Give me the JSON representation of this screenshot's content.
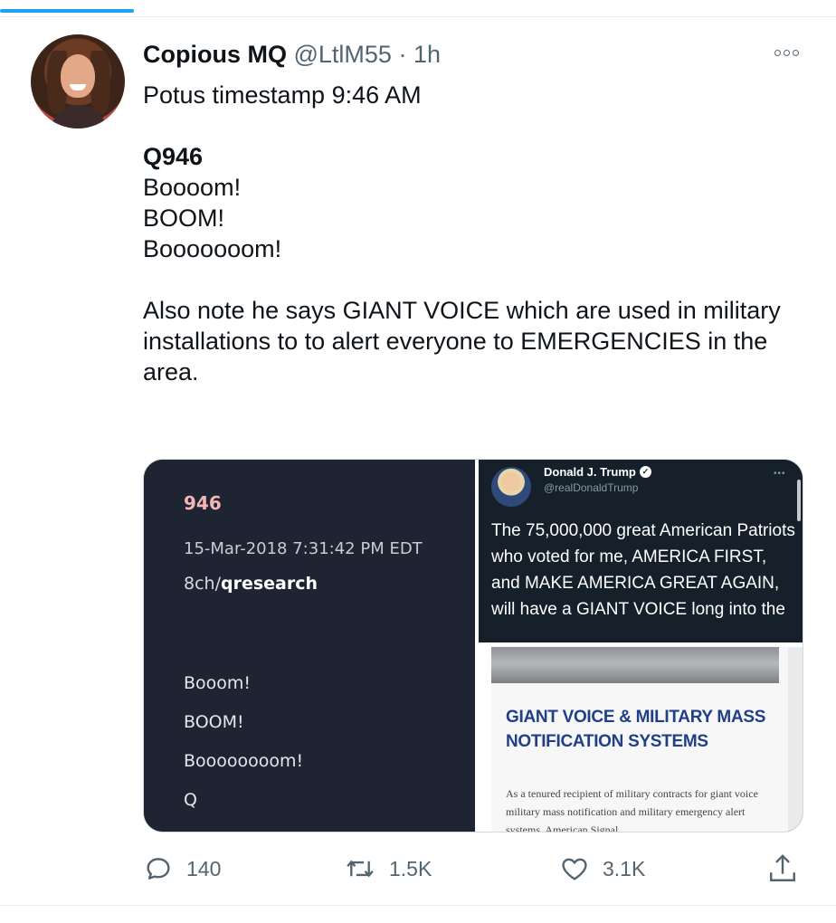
{
  "tweet": {
    "author_name": "Copious MQ",
    "handle": "@LtlM55",
    "dot": "·",
    "time": "1h",
    "text_line1": "Potus timestamp 9:46 AM",
    "bold_line": "Q946",
    "lines": [
      "Boooom!",
      "BOOM!",
      "Booooooom!"
    ],
    "paragraph": "Also note he says GIANT VOICE which are used in military installations to to alert everyone to EMERGENCIES in the area."
  },
  "media": {
    "q_post": {
      "number": "946",
      "date": "15-Mar-2018 7:31:42 PM EDT",
      "board_prefix": "8ch/",
      "board_name": "qresearch",
      "lines": "Booom!\nBOOM!\nBoooooooom!\nQ"
    },
    "trump_tweet": {
      "name": "Donald J. Trump",
      "handle": "@realDonaldTrump",
      "text": "The 75,000,000 great American Patriots who voted for me, AMERICA FIRST, and MAKE AMERICA GREAT AGAIN, will have a GIANT VOICE long into the"
    },
    "article": {
      "title": "GIANT VOICE & MILITARY MASS NOTIFICATION SYSTEMS",
      "body": "As a tenured recipient of military contracts for giant voice military mass notification and military emergency alert systems, American Signal"
    }
  },
  "actions": {
    "reply_count": "140",
    "retweet_count": "1.5K",
    "like_count": "3.1K"
  },
  "colors": {
    "accent": "#1da1f2",
    "muted": "#536471",
    "dark_panel": "#1f2433",
    "twitter_dark": "#15202b",
    "article_title": "#1f3f86"
  },
  "icons": {
    "reply": "speech-bubble",
    "retweet": "retweet-arrows",
    "like": "heart",
    "share": "share-upload",
    "more": "three-dots"
  }
}
